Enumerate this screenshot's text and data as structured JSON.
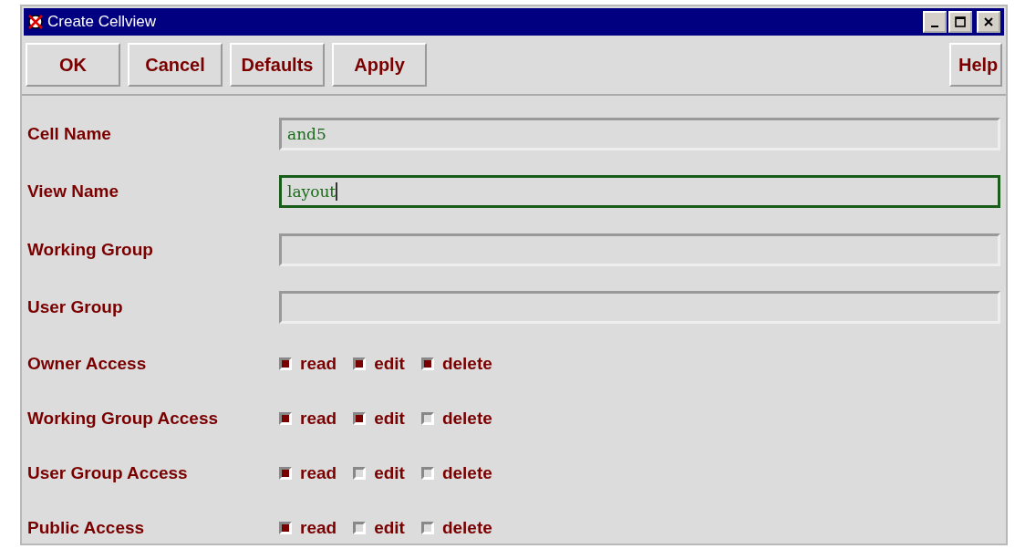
{
  "window": {
    "title": "Create Cellview"
  },
  "buttons": [
    "OK",
    "Cancel",
    "Defaults",
    "Apply"
  ],
  "help_button": "Help",
  "fields": [
    {
      "label": "Cell Name",
      "value": "and5",
      "focused": false
    },
    {
      "label": "View Name",
      "value": "layout",
      "focused": true
    },
    {
      "label": "Working Group",
      "focused": false
    },
    {
      "label": "User Group",
      "focused": false
    }
  ],
  "access": [
    {
      "label": "Owner Access",
      "options": [
        {
          "label": "read",
          "checked": true
        },
        {
          "label": "edit",
          "checked": true
        },
        {
          "label": "delete",
          "checked": true
        }
      ]
    },
    {
      "label": "Working Group Access",
      "options": [
        {
          "label": "read",
          "checked": true
        },
        {
          "label": "edit",
          "checked": true
        },
        {
          "label": "delete",
          "checked": false
        }
      ]
    },
    {
      "label": "User Group Access",
      "options": [
        {
          "label": "read",
          "checked": true
        },
        {
          "label": "edit",
          "checked": false
        },
        {
          "label": "delete",
          "checked": false
        }
      ]
    },
    {
      "label": "Public Access",
      "options": [
        {
          "label": "read",
          "checked": true
        },
        {
          "label": "edit",
          "checked": false
        },
        {
          "label": "delete",
          "checked": false
        }
      ]
    }
  ]
}
